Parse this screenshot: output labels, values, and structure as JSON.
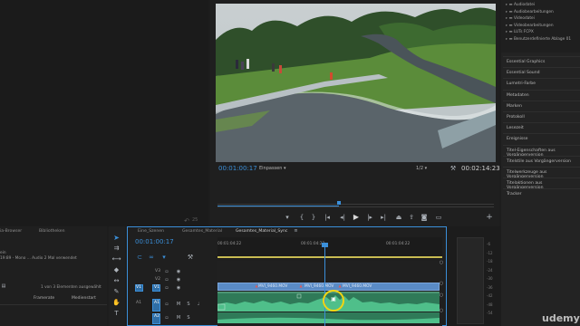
{
  "project_tree": {
    "items": [
      "Audiodatei",
      "Audiobearbeitungen",
      "Videodatei",
      "Videobearbeitungen",
      "LUTs FCPX",
      "Benutzerdefinierte Ablage 01"
    ]
  },
  "right_panel": {
    "items": [
      "Essential Graphics",
      "Essential Sound",
      "Lumetri-Farbe",
      "Metadaten",
      "Marken",
      "Protokoll",
      "Lesezeit",
      "Ereignisse",
      "Titel-Eigenschaften aus Vorgängerversion",
      "Titelstile aus Vorgängerversion",
      "Titelwerkzeuge aus Vorgängerversion",
      "Titelaktionen aus Vorgängerversion",
      "Tracker"
    ]
  },
  "program_monitor": {
    "timecode_left": "00:01:00:17",
    "fit_label": "Einpassen",
    "resolution": "1/2",
    "timecode_right": "00:02:14:23",
    "progress": 0.44
  },
  "left_panel": {
    "tab_media_browser": "ia-Browser",
    "tab_libraries": "Bibliotheken",
    "info_line1": "ein",
    "info_line2": "19:89 - Mono ... Audio 2 Mal verwendet",
    "status": "1 von 3 Elementen ausgewählt",
    "col_framerate": "Framerate",
    "col_medienstart": "Medienstart",
    "timecode_small": "25"
  },
  "timeline": {
    "tabs": [
      "Eine_Szenen",
      "Gesamtes_Material",
      "Gesamtes_Material_Sync"
    ],
    "active_tab": 2,
    "timecode": "00:01:00:17",
    "ruler": [
      "00:01:04:22",
      "00:01:04:22",
      "00:01:04:22"
    ],
    "tracks": {
      "v3": "V3",
      "v2": "V2",
      "v1_target": "V1",
      "v1": "V1",
      "a1_source": "A1",
      "a1": "A1",
      "a2": "A2"
    },
    "clips": [
      "MVI_9460.MOV",
      "MVI_9460.MOV",
      "MVI_9460.MOV"
    ]
  },
  "watermark": "udemy",
  "meter": {
    "ticks": [
      "-6",
      "-12",
      "-18",
      "-24",
      "-30",
      "-36",
      "-42",
      "-48",
      "-54"
    ]
  },
  "colors": {
    "accent": "#3b8fd9",
    "video_clip": "#5a8bc6",
    "audio_clip": "#2f7a58",
    "waveform": "#4fbf8a",
    "playhead": "#3b8fd9",
    "highlight": "#f3d511"
  }
}
